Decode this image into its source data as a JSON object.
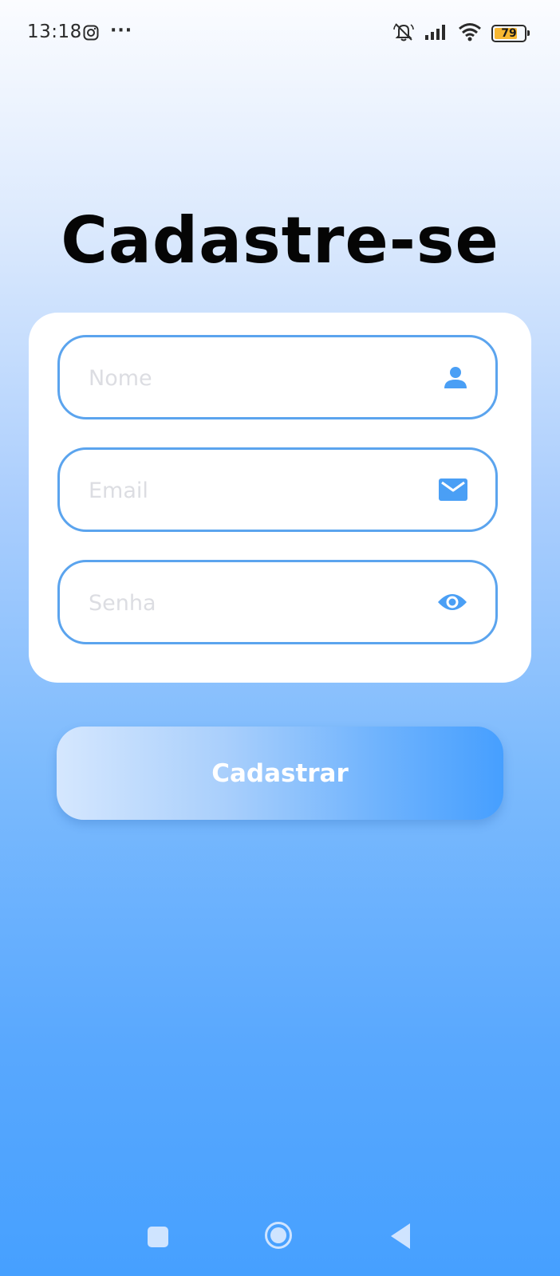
{
  "status_bar": {
    "time": "13:18",
    "notification_icons": [
      "instagram-icon",
      "more-dots-icon"
    ],
    "more_label": "···",
    "system_icons": [
      "muted-bell-icon",
      "signal-icon",
      "wifi-icon",
      "battery-icon"
    ],
    "battery_level": "79",
    "battery_color": "#f7b731"
  },
  "page": {
    "title": "Cadastre-se"
  },
  "form": {
    "fields": [
      {
        "placeholder": "Nome",
        "value": "",
        "icon": "person-icon"
      },
      {
        "placeholder": "Email",
        "value": "",
        "icon": "mail-icon"
      },
      {
        "placeholder": "Senha",
        "value": "",
        "icon": "eye-icon"
      }
    ],
    "submit_label": "Cadastrar"
  },
  "nav_bar": {
    "buttons": [
      "recents-square-icon",
      "home-circle-icon",
      "back-triangle-icon"
    ]
  },
  "colors": {
    "accent": "#4a9ff5",
    "field_border": "#5ba4ee",
    "background_top": "#fbfcff",
    "background_bottom": "#46a0ff"
  }
}
